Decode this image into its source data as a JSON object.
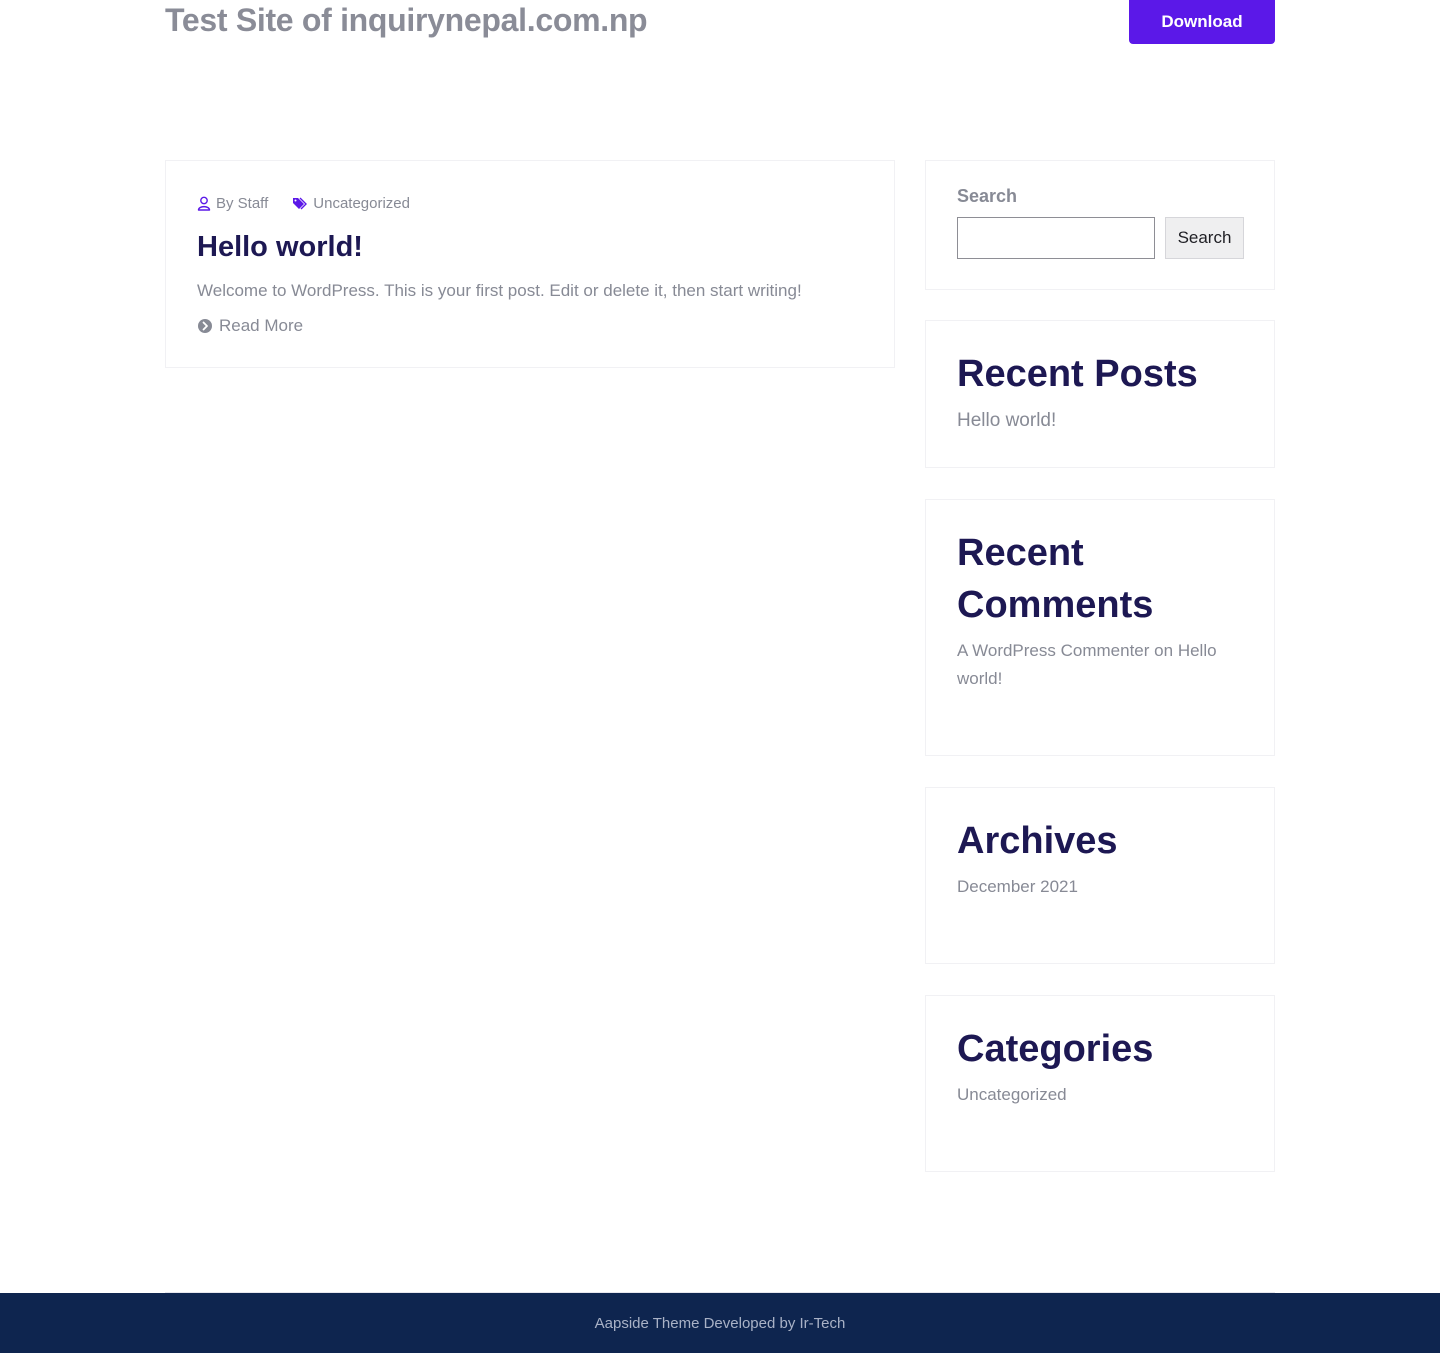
{
  "header": {
    "site_title": "Test Site of inquirynepal.com.np",
    "download_label": "Download"
  },
  "post": {
    "author": "By Staff",
    "category": "Uncategorized",
    "title": "Hello world!",
    "excerpt": "Welcome to WordPress. This is your first post. Edit or delete it, then start writing!",
    "read_more": "Read More"
  },
  "sidebar": {
    "search": {
      "label": "Search",
      "button": "Search",
      "placeholder": ""
    },
    "recent_posts": {
      "title": "Recent Posts",
      "items": [
        "Hello world!"
      ]
    },
    "recent_comments": {
      "title_line1": "Recent",
      "title_line2": "Comments",
      "author": "A WordPress Commenter",
      "connector": "on",
      "post_line1": "Hello",
      "post_line2": "world!"
    },
    "archives": {
      "title": "Archives",
      "items": [
        "December 2021"
      ]
    },
    "categories": {
      "title": "Categories",
      "items": [
        "Uncategorized"
      ]
    }
  },
  "footer": {
    "credit": "Aapside Theme Developed by Ir-Tech"
  },
  "colors": {
    "accent": "#5b18e8",
    "heading": "#1d1853",
    "body_text": "#878a95",
    "footer_bg": "#0e254f"
  }
}
